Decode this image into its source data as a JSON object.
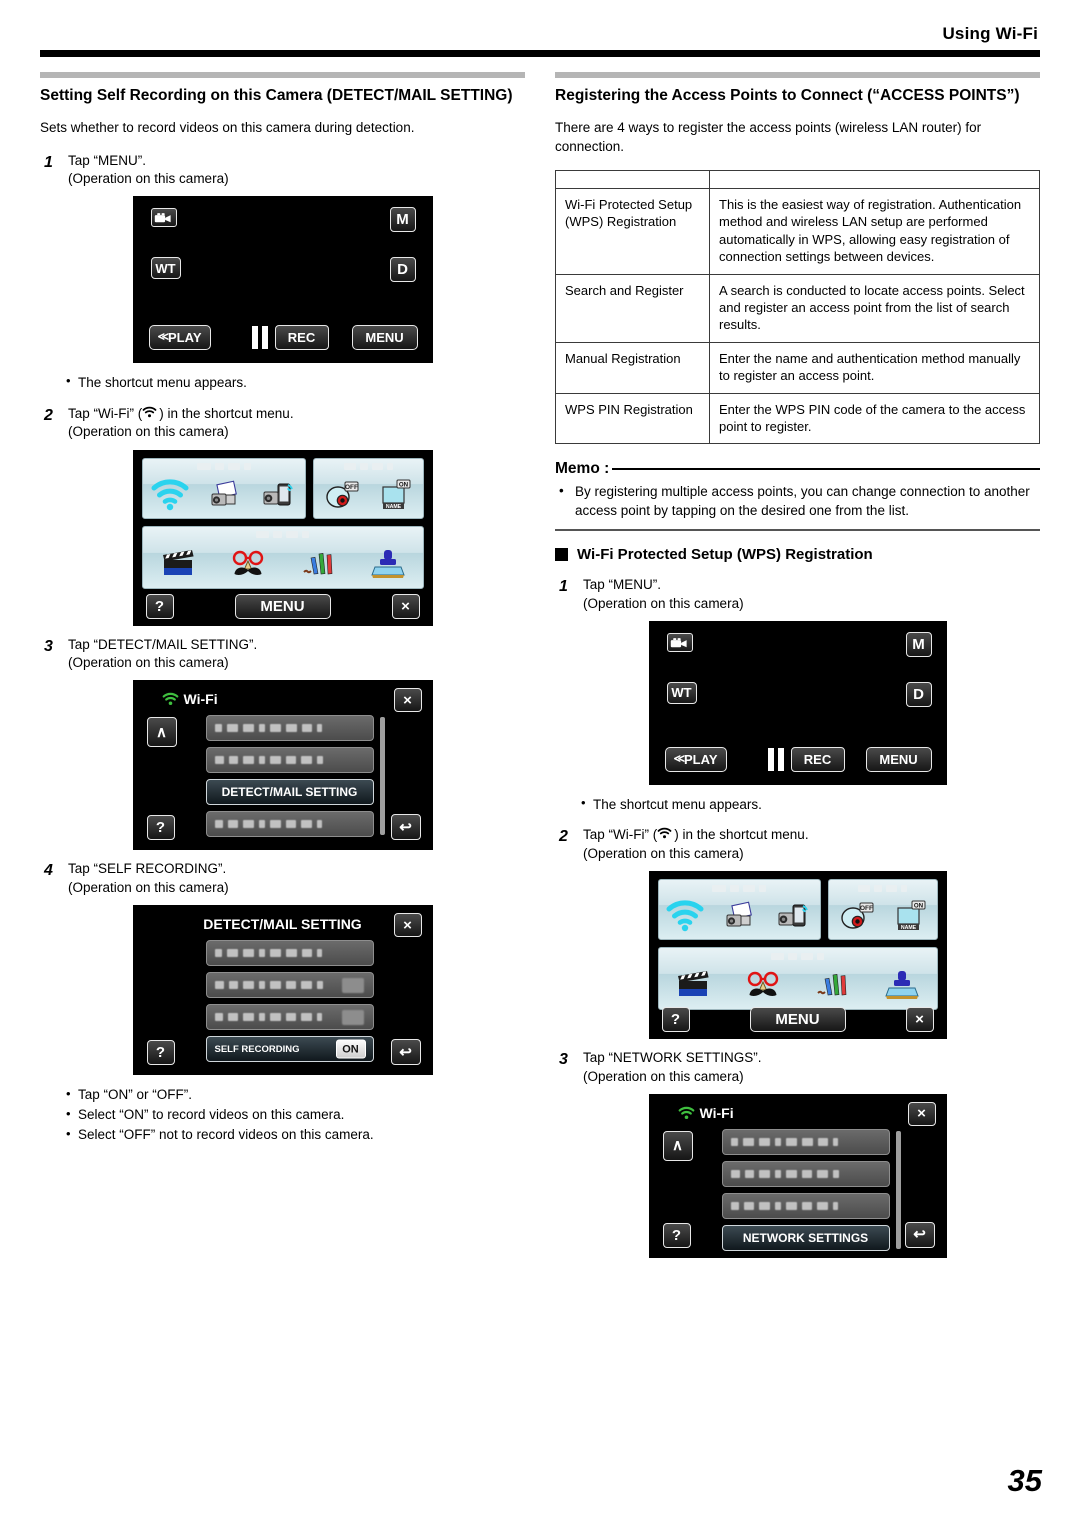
{
  "header": {
    "title": "Using Wi-Fi"
  },
  "page_number": "35",
  "left": {
    "section_title": "Setting Self Recording on this Camera (DETECT/MAIL SETTING)",
    "intro": "Sets whether to record videos on this camera during detection.",
    "steps": [
      {
        "num": "1",
        "text": "Tap “MENU”.",
        "sub": "(Operation on this camera)"
      },
      {
        "num": "2",
        "text": "Tap “Wi-Fi” (⌒) in the shortcut menu.",
        "text_a": "Tap “Wi-Fi” (",
        "text_b": ") in the shortcut menu.",
        "sub": "(Operation on this camera)"
      },
      {
        "num": "3",
        "text": "Tap “DETECT/MAIL SETTING”.",
        "sub": "(Operation on this camera)"
      },
      {
        "num": "4",
        "text": "Tap “SELF RECORDING”.",
        "sub": "(Operation on this camera)"
      }
    ],
    "note_after_step1": "The shortcut menu appears.",
    "final_bullets": [
      "Tap “ON” or “OFF”.",
      "Select “ON” to record videos on this camera.",
      "Select “OFF” not to record videos on this camera."
    ]
  },
  "right": {
    "section_title": "Registering the Access Points to Connect (“ACCESS POINTS”)",
    "intro": "There are 4 ways to register the access points (wireless LAN router) for connection.",
    "table": {
      "rows": [
        {
          "method": "Wi-Fi Protected Setup (WPS) Registration",
          "description": "This is the easiest way of registration. Authentication method and wireless LAN setup are performed automatically in WPS, allowing easy registration of connection settings between devices."
        },
        {
          "method": "Search and Register",
          "description": "A search is conducted to locate access points. Select and register an access point from the list of search results."
        },
        {
          "method": "Manual Registration",
          "description": "Enter the name and authentication method manually to register an access point."
        },
        {
          "method": "WPS PIN Registration",
          "description": "Enter the WPS PIN code of the camera to the access point to register."
        }
      ]
    },
    "memo": {
      "label": "Memo :",
      "text": "By registering multiple access points, you can change connection to another access point by tapping on the desired one from the list."
    },
    "sub_heading": "Wi-Fi Protected Setup (WPS) Registration",
    "steps": [
      {
        "num": "1",
        "text": "Tap “MENU”.",
        "sub": "(Operation on this camera)"
      },
      {
        "num": "2",
        "text_a": "Tap “Wi-Fi” (",
        "text_b": ") in the shortcut menu.",
        "sub": "(Operation on this camera)"
      },
      {
        "num": "3",
        "text": "Tap “NETWORK SETTINGS”.",
        "sub": "(Operation on this camera)"
      }
    ],
    "note_after_step1": "The shortcut menu appears."
  },
  "screens": {
    "record": {
      "mode_icon": "video-camera-icon",
      "m_label": "M",
      "wt_label": "WT",
      "d_label": "D",
      "play_label": "PLAY",
      "play_chevron": "≪",
      "rec_label": "REC",
      "menu_label": "MENU"
    },
    "shortcut_menu": {
      "icons": [
        "wifi-icon",
        "camera-mail-icon",
        "camera-phone-icon",
        "face-detect-off-icon",
        "name-on-icon",
        "clapperboard-icon",
        "mustache-glasses-icon",
        "pencils-icon",
        "stamp-icon"
      ],
      "help_label": "?",
      "menu_label": "MENU",
      "close_label": "×"
    },
    "wifi_list": {
      "title": "Wi-Fi",
      "selected_item": "DETECT/MAIL SETTING",
      "close_label": "×",
      "up_label": "∧",
      "help_label": "?",
      "back_label": "↩"
    },
    "detect_mail_setting": {
      "title": "DETECT/MAIL SETTING",
      "selected_item": "SELF RECORDING",
      "selected_value": "ON",
      "close_label": "×",
      "help_label": "?",
      "back_label": "↩"
    },
    "network_list": {
      "title": "Wi-Fi",
      "selected_item": "NETWORK SETTINGS",
      "close_label": "×",
      "up_label": "∧",
      "help_label": "?",
      "back_label": "↩"
    }
  },
  "colors": {
    "wifi_cyan": "#18cfe8",
    "wifi_green": "#3fbf3f",
    "header_rule": "#000000",
    "section_rule": "#b5b5b5"
  }
}
